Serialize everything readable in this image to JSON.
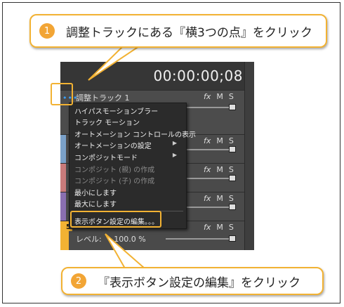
{
  "callouts": {
    "step1": {
      "number": "1",
      "text": "調整トラックにある『横3つの点』をクリック"
    },
    "step2": {
      "number": "2",
      "text": "『表示ボタン設定の編集』をクリック"
    }
  },
  "editor": {
    "timecode": "00:00:00;08",
    "track1": {
      "dots": "•••",
      "name": "調整トラック 1"
    },
    "buttons": {
      "fx": "fx",
      "mute": "M",
      "solo": "S"
    },
    "track5": {
      "badge": "5",
      "level_label": "レベル:",
      "level_value": "100.0 %"
    }
  },
  "menu": {
    "items": [
      {
        "label": "ハイパスモーションブラー",
        "disabled": false
      },
      {
        "label": "トラック モーション",
        "disabled": false
      },
      {
        "label": "オートメーション コントロールの表示",
        "disabled": false
      },
      {
        "label": "オートメーションの設定",
        "disabled": false,
        "submenu": true
      },
      {
        "label": "コンポジットモード",
        "disabled": false,
        "submenu": true
      },
      {
        "label": "コンポジット (親) の作成",
        "disabled": true
      },
      {
        "label": "コンポジット (子) の作成",
        "disabled": true
      },
      {
        "label": "最小にします",
        "disabled": false
      },
      {
        "label": "最大にします",
        "disabled": false
      },
      {
        "label": "表示ボタン設定の編集。。。",
        "disabled": false
      }
    ],
    "submenu_arrow": "▶"
  },
  "colors": {
    "accent": "#f2b233",
    "number_badge": "#f2a535",
    "dots_blue": "#3aa0ff"
  }
}
